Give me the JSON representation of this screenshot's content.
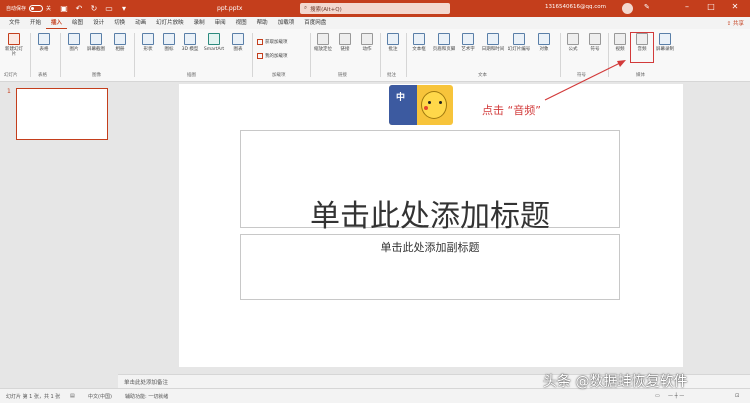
{
  "titlebar": {
    "autosave_label": "自动保存",
    "autosave_state": "关",
    "doc_name": "ppt.pptx",
    "search_placeholder": "搜索(Alt+Q)",
    "account": "1316540616@qq.com"
  },
  "tabs": [
    "文件",
    "开始",
    "插入",
    "绘图",
    "设计",
    "切换",
    "动画",
    "幻灯片放映",
    "录制",
    "审阅",
    "视图",
    "帮助",
    "加载项",
    "百度网盘"
  ],
  "active_tab": "插入",
  "share_label": "共享",
  "ribbon": {
    "buttons": [
      {
        "label": "新建幻灯片",
        "icon": "new-slide-icon"
      },
      {
        "label": "表格",
        "icon": "table-icon"
      },
      {
        "label": "图片",
        "icon": "picture-icon"
      },
      {
        "label": "屏幕截图",
        "icon": "screenshot-icon"
      },
      {
        "label": "相册",
        "icon": "album-icon"
      },
      {
        "label": "形状",
        "icon": "shapes-icon"
      },
      {
        "label": "图标",
        "icon": "icons-icon"
      },
      {
        "label": "3D 模型",
        "icon": "3d-model-icon"
      },
      {
        "label": "SmartArt",
        "icon": "smartart-icon"
      },
      {
        "label": "图表",
        "icon": "chart-icon"
      },
      {
        "label": "缩放定位",
        "icon": "zoom-icon"
      },
      {
        "label": "链接",
        "icon": "link-icon"
      },
      {
        "label": "动作",
        "icon": "action-icon"
      },
      {
        "label": "批注",
        "icon": "comment-icon"
      },
      {
        "label": "文本框",
        "icon": "textbox-icon"
      },
      {
        "label": "页眉和页脚",
        "icon": "header-footer-icon"
      },
      {
        "label": "艺术字",
        "icon": "wordart-icon"
      },
      {
        "label": "日期和时间",
        "icon": "date-time-icon"
      },
      {
        "label": "幻灯片编号",
        "icon": "slide-number-icon"
      },
      {
        "label": "对象",
        "icon": "object-icon"
      },
      {
        "label": "公式",
        "icon": "equation-icon"
      },
      {
        "label": "符号",
        "icon": "symbol-icon"
      },
      {
        "label": "视频",
        "icon": "video-icon"
      },
      {
        "label": "音频",
        "icon": "audio-icon"
      },
      {
        "label": "屏幕录制",
        "icon": "screen-recording-icon"
      }
    ],
    "addin_get": "获取加载项",
    "addin_my": "我的加载项",
    "groups": [
      "幻灯片",
      "表格",
      "图像",
      "插图",
      "加载项",
      "链接",
      "批注",
      "文本",
      "符号",
      "媒体"
    ]
  },
  "slide_number": "1",
  "slide": {
    "title_placeholder": "单击此处添加标题",
    "subtitle_placeholder": "单击此处添加副标题",
    "media_char": "中"
  },
  "annotation": "点击 “音频”",
  "notes_placeholder": "单击此处添加备注",
  "status": {
    "slide_info": "幻灯片 第 1 张，共 1 张",
    "language": "中文(中国)",
    "accessibility": "辅助功能: 一切就绪"
  },
  "watermark": "头条 @数据蛙恢复软件",
  "colors": {
    "accent": "#c43e1c",
    "highlight": "#d23a3a"
  }
}
